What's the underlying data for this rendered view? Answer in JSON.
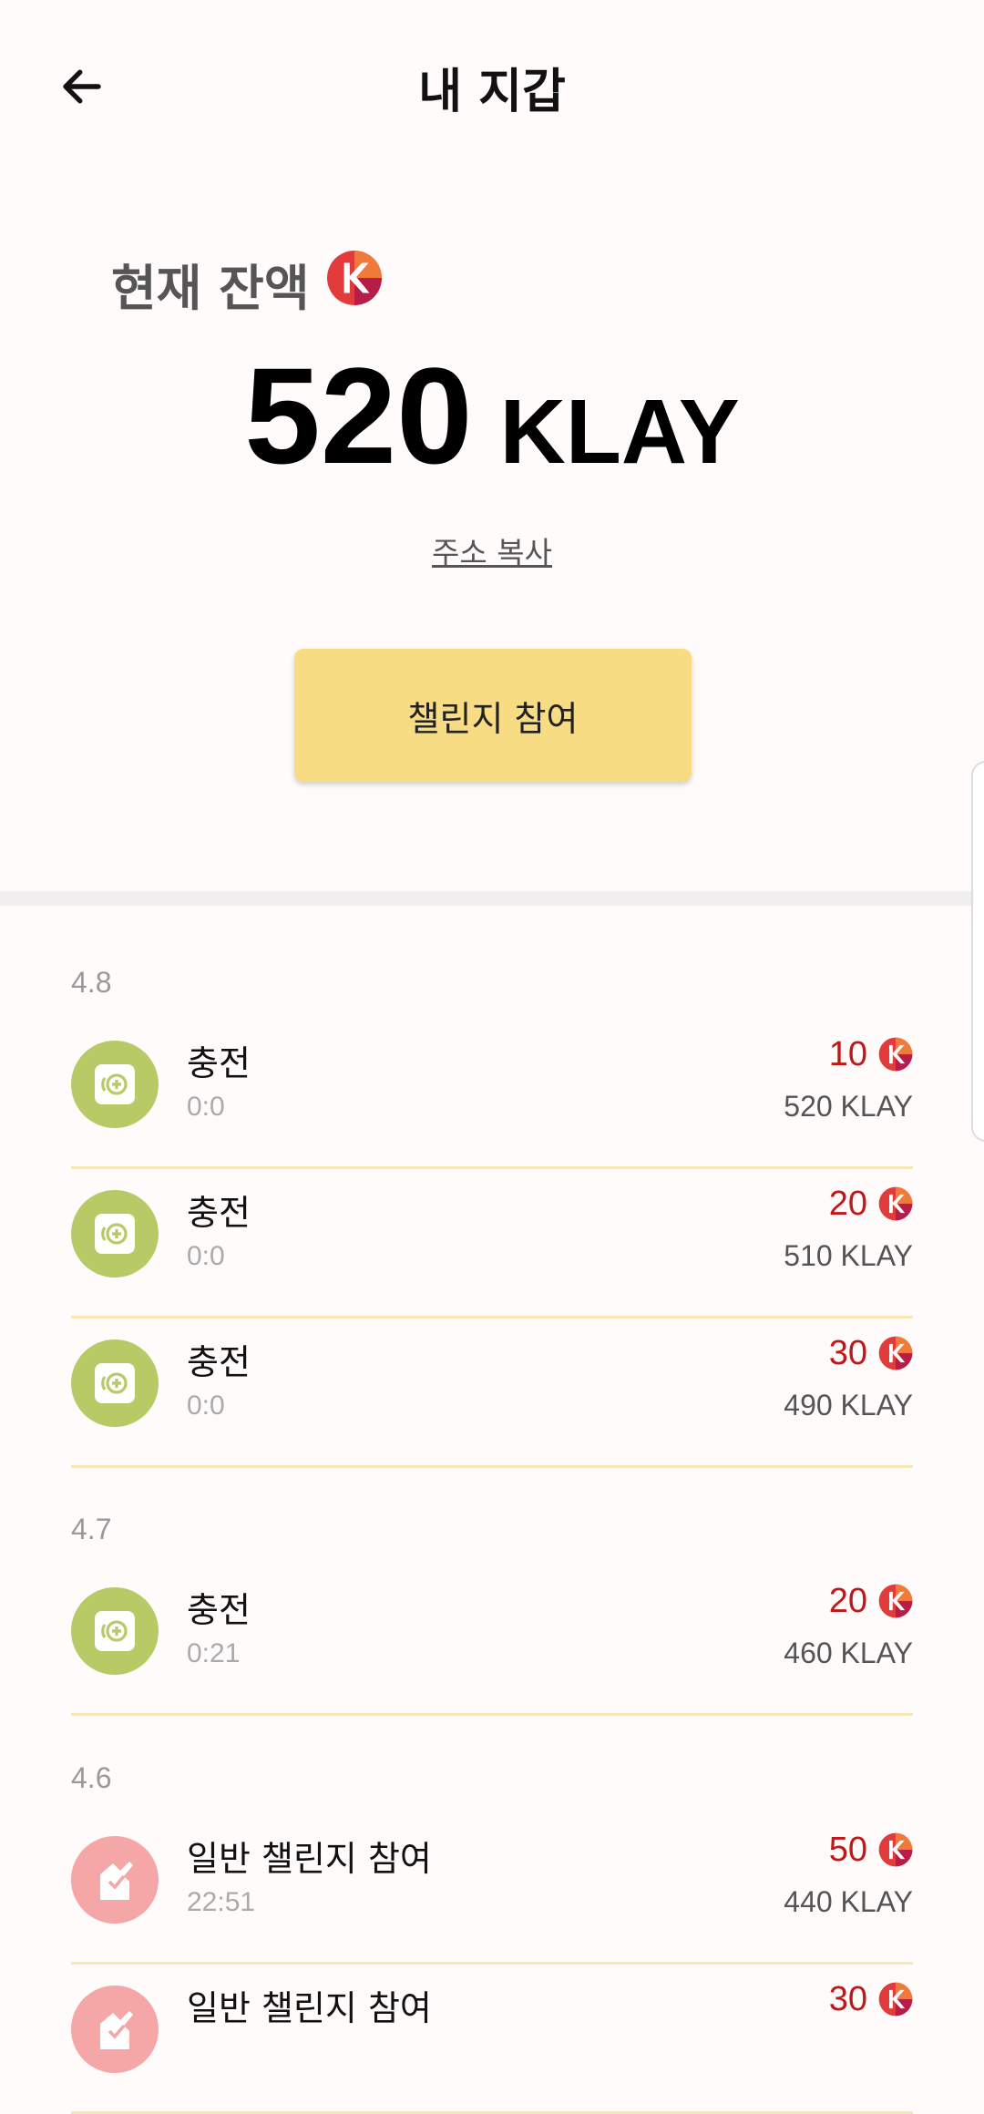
{
  "header": {
    "title": "내 지갑"
  },
  "wallet": {
    "balance_label": "현재 잔액",
    "balance_amount": "520",
    "balance_unit": "KLAY",
    "copy_address": "주소 복사",
    "challenge_button": "챌린지 참여"
  },
  "groups": [
    {
      "date": "4.8",
      "items": [
        {
          "title": "충전",
          "time": "0:0",
          "amount": "10",
          "balance": "520 KLAY",
          "icon": "charge-icon"
        },
        {
          "title": "충전",
          "time": "0:0",
          "amount": "20",
          "balance": "510 KLAY",
          "icon": "charge-icon"
        },
        {
          "title": "충전",
          "time": "0:0",
          "amount": "30",
          "balance": "490 KLAY",
          "icon": "charge-icon"
        }
      ]
    },
    {
      "date": "4.7",
      "items": [
        {
          "title": "충전",
          "time": "0:21",
          "amount": "20",
          "balance": "460 KLAY",
          "icon": "charge-icon"
        }
      ]
    },
    {
      "date": "4.6",
      "items": [
        {
          "title": "일반 챌린지 참여",
          "time": "22:51",
          "amount": "50",
          "balance": "440 KLAY",
          "icon": "challenge-icon"
        },
        {
          "title": "일반 챌린지 참여",
          "time": "",
          "amount": "30",
          "balance": "",
          "icon": "challenge-icon"
        }
      ]
    }
  ],
  "colors": {
    "background": "#fffbfb",
    "accent_button": "#f7dc84",
    "amount_red": "#c01818",
    "charge_icon_bg": "#b8ca66",
    "challenge_icon_bg": "#f5a6a6",
    "row_divider": "#f6e7b4"
  }
}
